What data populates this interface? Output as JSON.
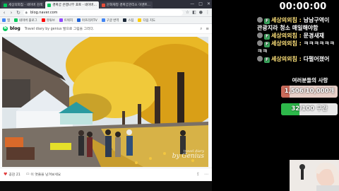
{
  "browser": {
    "tabs": [
      {
        "label": "세상의외침 - 네이버 검색",
        "active": false,
        "favicon": "#03c75a"
      },
      {
        "label": "경복궁 은행나무 포토 - 네이버...",
        "active": true,
        "favicon": "#03c75a"
      },
      {
        "label": "문화재청 경복궁관리소 이벤트...",
        "active": false,
        "favicon": "#e44d3a"
      }
    ],
    "window_controls": [
      "—",
      "□",
      "✕"
    ],
    "url": "blog.naver.com",
    "bookmarks": [
      {
        "label": "앱",
        "color": "#4285f4"
      },
      {
        "label": "네이버 블로그",
        "color": "#03c75a"
      },
      {
        "label": "유튜브",
        "color": "#ff0000"
      },
      {
        "label": "트위치",
        "color": "#9146ff"
      },
      {
        "label": "아프리카TV",
        "color": "#1e62d6"
      },
      {
        "label": "구글 번역",
        "color": "#4285f4"
      },
      {
        "label": "스팀",
        "color": "#1b2838"
      },
      {
        "label": "다음 지도",
        "color": "#ffcd00"
      }
    ],
    "blog": {
      "logo_badge": "N",
      "logo_word": "blog",
      "title": "Travel diary by genius 발으로 그림을 그리다.",
      "right_icons": [
        "search-icon",
        "menu-icon"
      ]
    },
    "photo": {
      "watermark_line1": "travel diary",
      "watermark_line2": "by Genius"
    },
    "footer": {
      "likes_label": "공감 21",
      "comments_label": "이 엿줄을 남겨보세요",
      "share_icon": "share-icon",
      "more_icon": "more-icon"
    }
  },
  "overlay": {
    "timer": "00:00:00",
    "chat": [
      {
        "type": "continuation",
        "text": "관광지라 청소 매일해야함"
      },
      {
        "type": "message",
        "nick": "세상의외침",
        "text": "문경새재"
      },
      {
        "type": "message",
        "nick": "세상의외침",
        "text": "ㅋㅋㅋㅋㅋㅋ"
      },
      {
        "type": "continuation",
        "text": "ㅋㅋ"
      },
      {
        "type": "message",
        "nick": "세상의외침",
        "text": "다펄어졌어"
      }
    ],
    "chat_top_partial": {
      "nick": "세상의외침",
      "text": "남남구역이"
    },
    "subtitle": "여러분들의 사랑",
    "goals": [
      {
        "label": "1,506/10,000개",
        "progress": 0.15,
        "fill_color": "#c96a5a"
      },
      {
        "label": "32/100 구간",
        "progress": 0.32,
        "fill_color": "#2db84a"
      }
    ]
  }
}
